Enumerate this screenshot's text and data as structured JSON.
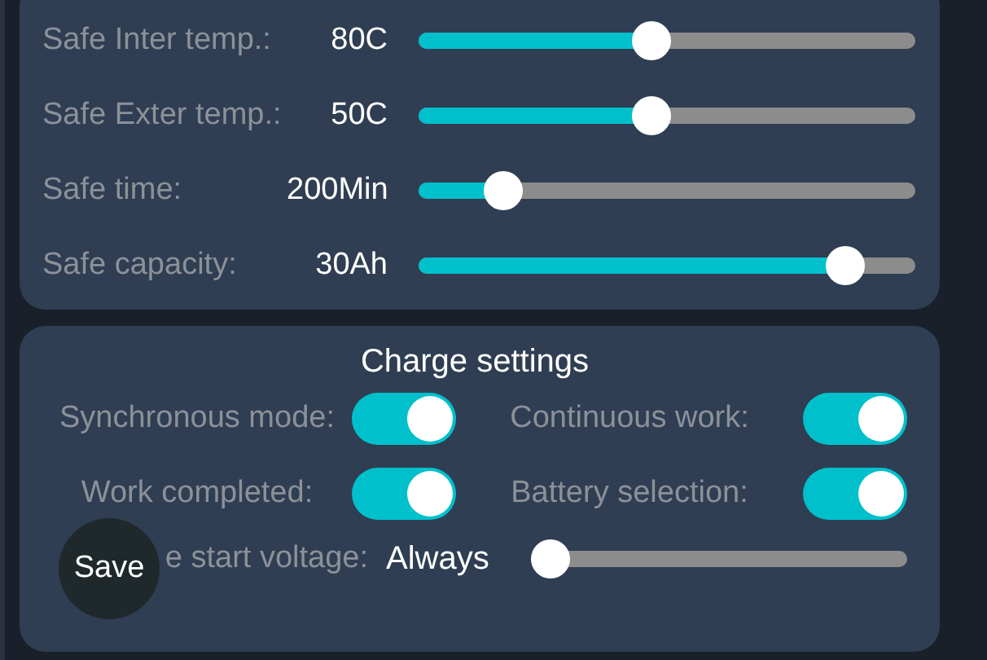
{
  "safety_sliders": [
    {
      "label": "Safe Inter temp.:",
      "value": "80C",
      "level": 0.47
    },
    {
      "label": "Safe Exter temp.:",
      "value": "50C",
      "level": 0.47
    },
    {
      "label": "Safe time:",
      "value": "200Min",
      "level": 0.17
    },
    {
      "label": "Safe capacity:",
      "value": "30Ah",
      "level": 0.86
    }
  ],
  "charge_settings": {
    "title": "Charge settings",
    "toggles": [
      {
        "label": "Synchronous mode:",
        "on": true
      },
      {
        "label": "Continuous work:",
        "on": true
      },
      {
        "label": "Work completed:",
        "on": true
      },
      {
        "label": "Battery selection:",
        "on": true
      }
    ],
    "start_voltage": {
      "label": "e start voltage:",
      "value": "Always",
      "level": 0
    }
  },
  "save_button": {
    "label": "Save"
  }
}
